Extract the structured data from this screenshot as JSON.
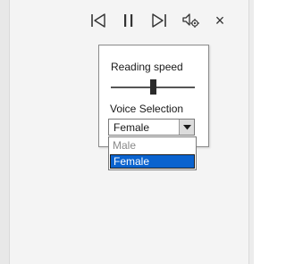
{
  "player_controls": {
    "previous_icon": "skip-back-icon",
    "pause_icon": "pause-icon",
    "next_icon": "skip-forward-icon",
    "voice_settings_icon": "voice-settings-icon",
    "close_label": "×"
  },
  "popup": {
    "reading_speed_label": "Reading speed",
    "reading_speed_value_fraction": 0.5,
    "voice_selection_label": "Voice Selection",
    "voice_selected": "Female",
    "voice_options": [
      "Male",
      "Female"
    ],
    "highlighted_option": "Female"
  },
  "colors": {
    "selection_highlight": "#0a63cf",
    "panel_background": "#f4f4f4"
  }
}
